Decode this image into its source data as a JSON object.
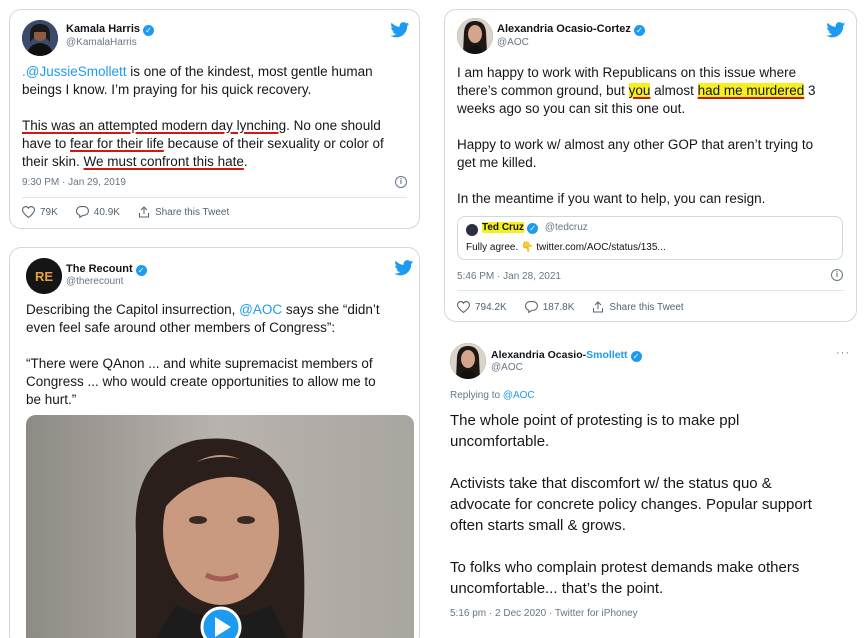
{
  "tweet_harris": {
    "name": "Kamala Harris",
    "handle": "@KamalaHarris",
    "mention": ".@JussieSmollett",
    "line1_rest": " is one of the kindest, most gentle human",
    "line2": "beings I know. I’m praying for his quick recovery.",
    "line3_ul": "This was an attempted modern day lynching",
    "line3_rest": ". No one should",
    "line4_a": "have to ",
    "line4_ul": "fear for their life",
    "line4_rest": " because of their sexuality or color of",
    "line5_a": "their skin. ",
    "line5_ul": "We must confront this hate",
    "line5_end": ".",
    "timestamp": "9:30 PM · Jan 29, 2019",
    "likes": "79K",
    "replies": "40.9K",
    "share": "Share this Tweet"
  },
  "tweet_recount": {
    "name": "The Recount",
    "handle": "@therecount",
    "logo_text": "RE",
    "line1_a": "Describing the Capitol insurrection, ",
    "line1_mention": "@AOC",
    "line1_rest": " says she “didn’t",
    "line2": "even feel safe around other members of Congress”:",
    "line3": "“There were QAnon ... and white supremacist members of",
    "line4": "Congress ... who would create opportunities to allow me to",
    "line5": "be hurt.”"
  },
  "tweet_aoc": {
    "name": "Alexandria Ocasio-Cortez",
    "handle": "@AOC",
    "line1": "I am happy to work with Republicans on this issue where",
    "line2_a": "there’s common ground, but ",
    "line2_hl1": "you",
    "line2_b": " almost ",
    "line2_hl2": "had me murdered",
    "line2_c": " 3",
    "line3": "weeks ago so you can sit this one out.",
    "line4": "Happy to work w/ almost any other GOP that aren’t trying to",
    "line5": "get me killed.",
    "line6": "In the meantime if you want to help, you can resign.",
    "quote_name": "Ted Cruz",
    "quote_handle": "@tedcruz",
    "quote_text": "Fully agree. 👇 twitter.com/AOC/status/135...",
    "timestamp": "5:46 PM · Jan 28, 2021",
    "likes": "794.2K",
    "replies": "187.8K",
    "share": "Share this Tweet"
  },
  "tweet_parody": {
    "name_a": "Alexandria Ocasio-",
    "name_b": "Smollett",
    "handle": "@AOC",
    "more": "···",
    "replying_label": "Replying to ",
    "replying_to": "@AOC",
    "line1": "The whole point of protesting is to make ppl",
    "line2": "uncomfortable.",
    "line3": "Activists take that discomfort w/ the status quo &",
    "line4": "advocate for concrete policy changes. Popular support",
    "line5": "often starts small & grows.",
    "line6": "To folks who complain protest demands make others",
    "line7": "uncomfortable... that’s the point.",
    "timestamp": "5:16 pm · 2 Dec 2020 · Twitter for iPhoney"
  },
  "colors": {
    "twitter_blue": "#1d9bf0",
    "underline_red": "#d01818",
    "highlight_yellow": "#f7ef21"
  }
}
